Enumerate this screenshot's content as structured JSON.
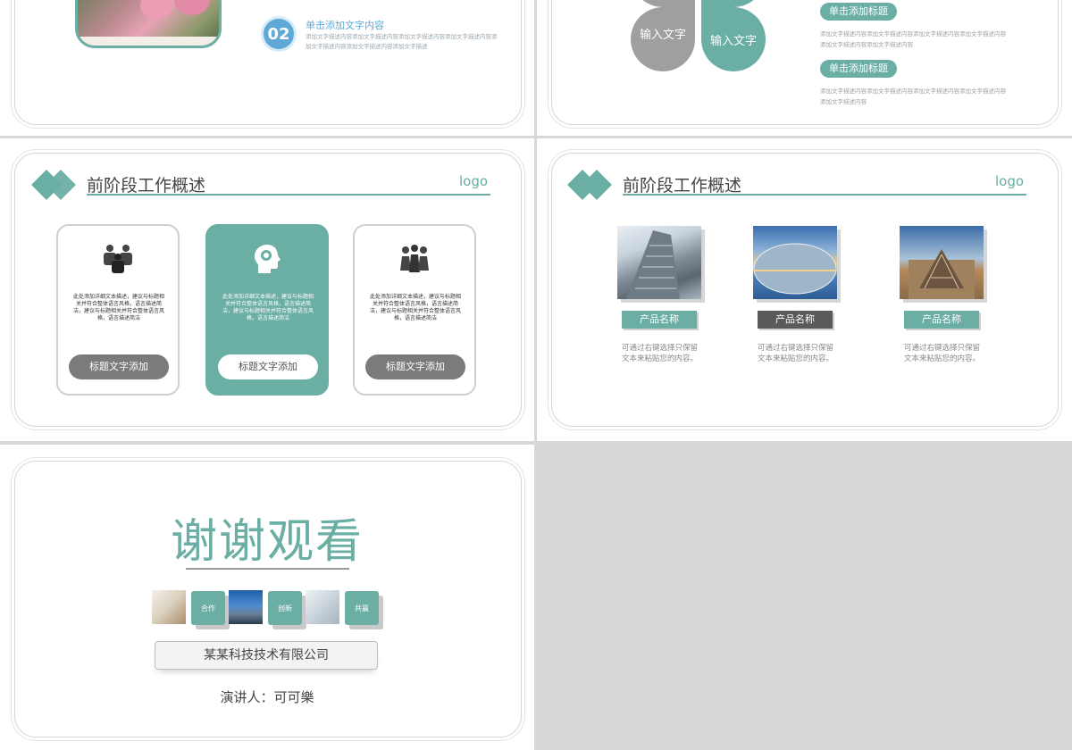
{
  "slide1": {
    "number": "02",
    "title": "单击添加文字内容",
    "text": "添加文字描述内容添加文字描述内容添加文字描述内容添加文字描述内容添加文字描述内容添加文字描述内容添加文字描述"
  },
  "slide2": {
    "petal_left": "输入文字",
    "petal_right": "输入文字",
    "pill1": "单击添加标题",
    "pill2": "单击添加标题",
    "text1": "添加文字描述内容添加文字描述内容添加文字描述内容添加文字描述内容添加文字描述内容添加文字描述内容",
    "text2": "添加文字描述内容添加文字描述内容添加文字描述内容添加文字描述内容添加文字描述内容"
  },
  "slide3": {
    "title": "前阶段工作概述",
    "logo": "logo",
    "cards": [
      {
        "icon": "team-icon",
        "desc": "此处添加详细文本描述，建议与标题相关并符合整体语言风格，语言描述简洁，建议与标题相关并符合整体语言风格，语言描述简洁",
        "button": "标题文字添加"
      },
      {
        "icon": "head-brain-icon",
        "desc": "此处添加详细文本描述，建议与标题相关并符合整体语言风格，语言描述简洁，建议与标题相关并符合整体语言风格，语言描述简洁",
        "button": "标题文字添加"
      },
      {
        "icon": "people-group-icon",
        "desc": "此处添加详细文本描述，建议与标题相关并符合整体语言风格，语言描述简洁，建议与标题相关并符合整体语言风格，语言描述简洁",
        "button": "标题文字添加"
      }
    ]
  },
  "slide4": {
    "title": "前阶段工作概述",
    "logo": "logo",
    "products": [
      {
        "name": "产品名称",
        "desc": "可通过右键选择只保留文本来粘贴您的内容。",
        "color": "#6aaea4"
      },
      {
        "name": "产品名称",
        "desc": "可通过右键选择只保留文本来粘贴您的内容。",
        "color": "#5a5a5a"
      },
      {
        "name": "产品名称",
        "desc": "可通过右键选择只保留文本来粘贴您的内容。",
        "color": "#6aaea4"
      }
    ]
  },
  "slide5": {
    "title": "谢谢观看",
    "tags": [
      "合作",
      "创新",
      "共赢"
    ],
    "company": "某某科技技术有限公司",
    "presenter": "演讲人：可可樂"
  },
  "colors": {
    "accent": "#6aaea4",
    "gray": "#9f9f9f",
    "blue": "#5fa9d6"
  }
}
